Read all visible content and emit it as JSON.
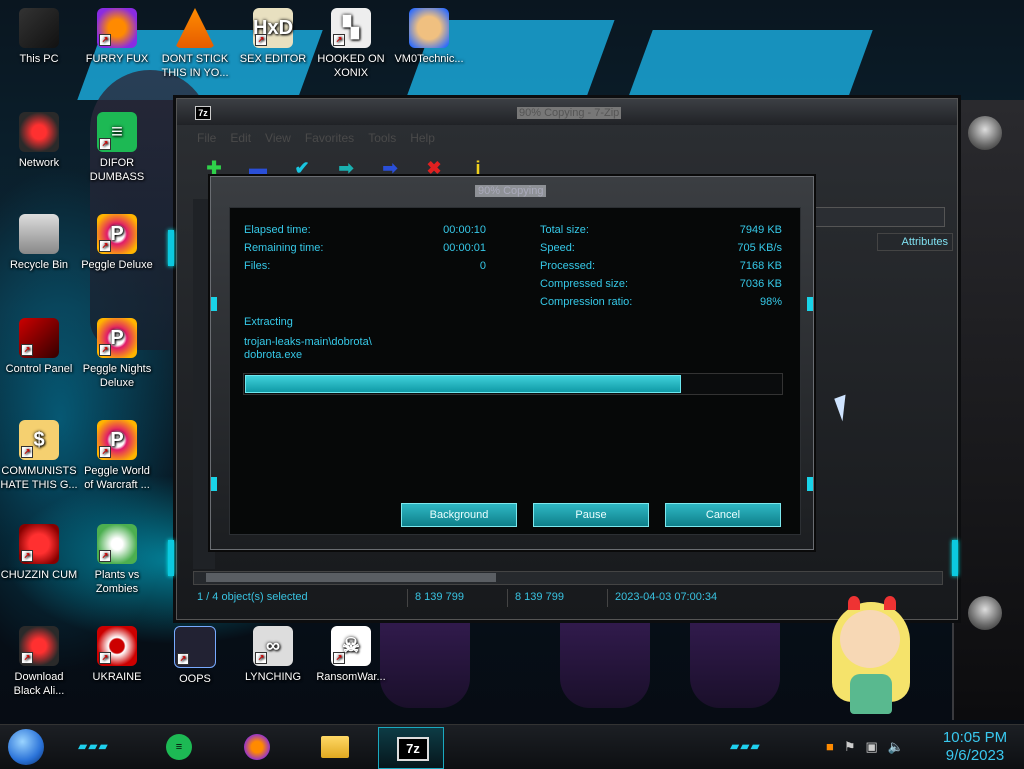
{
  "desktop": {
    "icons": [
      {
        "label": "This PC"
      },
      {
        "label": "FURRY FUX"
      },
      {
        "label": "DONT STICK THIS IN YO..."
      },
      {
        "label": "SEX EDITOR"
      },
      {
        "label": "HOOKED ON XONIX"
      },
      {
        "label": "VM0Technic..."
      },
      {
        "label": "Network"
      },
      {
        "label": "DIFOR DUMBASS"
      },
      {
        "label": "Recycle Bin"
      },
      {
        "label": "Peggle Deluxe"
      },
      {
        "label": "Control Panel"
      },
      {
        "label": "Peggle Nights Deluxe"
      },
      {
        "label": "COMMUNISTS HATE THIS G..."
      },
      {
        "label": "Peggle World of Warcraft ..."
      },
      {
        "label": "CHUZZIN CUM"
      },
      {
        "label": "Plants vs Zombies"
      },
      {
        "label": "Download Black Ali..."
      },
      {
        "label": "UKRAINE"
      },
      {
        "label": "OOPS"
      },
      {
        "label": "LYNCHING"
      },
      {
        "label": "RansomWar..."
      }
    ]
  },
  "sevenzip": {
    "app_badge": "7z",
    "window_title": "90% Copying - 7-Zip",
    "menu": [
      "File",
      "Edit",
      "View",
      "Favorites",
      "Tools",
      "Help"
    ],
    "columns": {
      "attributes": "Attributes"
    },
    "status": {
      "selected": "1 / 4 object(s) selected",
      "size": "8 139 799",
      "packed": "8 139 799",
      "modified": "2023-04-03 07:00:34"
    }
  },
  "progress_dialog": {
    "title": "90% Copying",
    "left": [
      {
        "label": "Elapsed time:",
        "value": "00:00:10"
      },
      {
        "label": "Remaining time:",
        "value": "00:00:01"
      },
      {
        "label": "Files:",
        "value": "0"
      }
    ],
    "right": [
      {
        "label": "Total size:",
        "value": "7949 KB"
      },
      {
        "label": "Speed:",
        "value": "705 KB/s"
      },
      {
        "label": "Processed:",
        "value": "7168 KB"
      },
      {
        "label": "Compressed size:",
        "value": "7036 KB"
      },
      {
        "label": "Compression ratio:",
        "value": "98%"
      }
    ],
    "operation": "Extracting",
    "path_line1": "trojan-leaks-main\\dobrota\\",
    "path_line2": "dobrota.exe",
    "progress_percent": 90,
    "buttons": {
      "background": "Background",
      "pause": "Pause",
      "cancel": "Cancel"
    }
  },
  "taskbar": {
    "clock_time": "10:05 PM",
    "clock_date": "9/6/2023",
    "active_app_label": "7z"
  },
  "colors": {
    "accent_cyan": "#36c9e8",
    "button_teal": "#1ba5b2",
    "clock": "#39c8ef"
  }
}
